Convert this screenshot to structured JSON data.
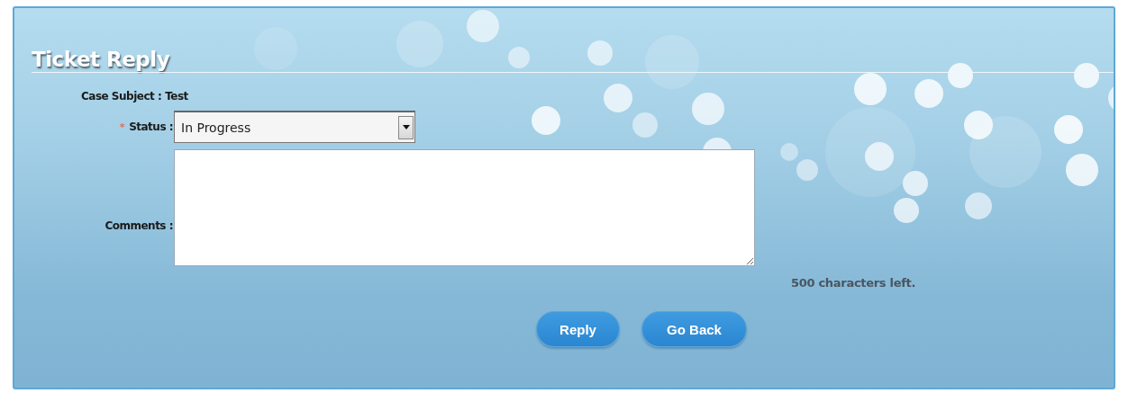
{
  "page": {
    "title": "Ticket Reply"
  },
  "case_subject": {
    "label": "Case Subject :",
    "value": "Test"
  },
  "status": {
    "required_mark": "*",
    "label": "Status :",
    "value": "In Progress"
  },
  "comments": {
    "label": "Comments :"
  },
  "char_counter": "500 characters left.",
  "buttons": [
    {
      "label": "Reply"
    },
    {
      "label": "Go Back"
    }
  ]
}
